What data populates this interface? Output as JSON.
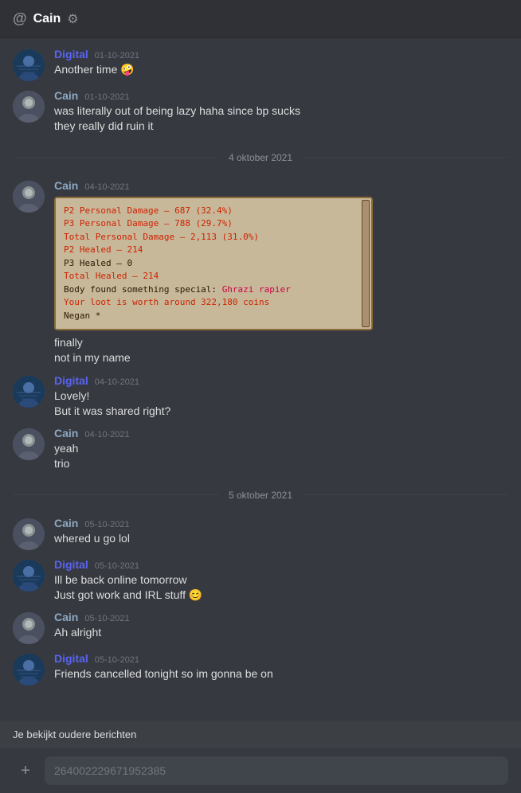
{
  "header": {
    "at_symbol": "@",
    "title": "Cain",
    "settings_icon": "⚙"
  },
  "dividers": {
    "d1": "4 oktober 2021",
    "d2": "5 oktober 2021"
  },
  "messages": [
    {
      "id": "msg1",
      "user": "Digital",
      "user_class": "digital",
      "timestamp": "01-10-2021",
      "lines": [
        "Another time 🤪"
      ]
    },
    {
      "id": "msg2",
      "user": "Cain",
      "user_class": "cain",
      "timestamp": "01-10-2021",
      "lines": [
        "was literally out of being lazy haha since bp sucks",
        "they really did ruin it"
      ]
    },
    {
      "id": "msg3",
      "user": "Cain",
      "user_class": "cain",
      "timestamp": "04-10-2021",
      "lines": [],
      "has_embed": true,
      "embed_lines": [
        {
          "text": "P2 Personal Damage - 687 (32.4%)",
          "color": "red"
        },
        {
          "text": "P3 Personal Damage - 788 (29.7%)",
          "color": "red"
        },
        {
          "text": "Total Personal Damage - 2,113 (31.0%)",
          "color": "red"
        },
        {
          "text": "P2 Healed - 214",
          "color": "red"
        },
        {
          "text": "P3 Healed - 0",
          "color": "normal"
        },
        {
          "text": "Total Healed - 214",
          "color": "red"
        },
        {
          "text": "Body found something special: Ghrazi rapier",
          "color": "special"
        },
        {
          "text": "Your loot is worth around 322,180 coins",
          "color": "red"
        },
        {
          "text": "Negan *",
          "color": "normal"
        }
      ],
      "after_embed_lines": [
        "finally",
        "not  in my name"
      ]
    },
    {
      "id": "msg4",
      "user": "Digital",
      "user_class": "digital",
      "timestamp": "04-10-2021",
      "lines": [
        "Lovely!",
        "But it was shared right?"
      ]
    },
    {
      "id": "msg5",
      "user": "Cain",
      "user_class": "cain",
      "timestamp": "04-10-2021",
      "lines": [
        "yeah",
        "trio"
      ]
    },
    {
      "id": "msg6",
      "user": "Cain",
      "user_class": "cain",
      "timestamp": "05-10-2021",
      "lines": [
        "whered u go lol"
      ]
    },
    {
      "id": "msg7",
      "user": "Digital",
      "user_class": "digital",
      "timestamp": "05-10-2021",
      "lines": [
        "Ill be back online tomorrow",
        "Just got work and IRL stuff 😊"
      ]
    },
    {
      "id": "msg8",
      "user": "Cain",
      "user_class": "cain",
      "timestamp": "05-10-2021",
      "lines": [
        "Ah alright"
      ]
    },
    {
      "id": "msg9",
      "user": "Digital",
      "user_class": "digital",
      "timestamp": "05-10-2021",
      "lines": [
        "Friends cancelled tonight so im gonna be on"
      ]
    }
  ],
  "bottom": {
    "viewing_older": "Je bekijkt oudere berichten",
    "input_placeholder": "264002229671952385",
    "add_button_label": "+"
  }
}
